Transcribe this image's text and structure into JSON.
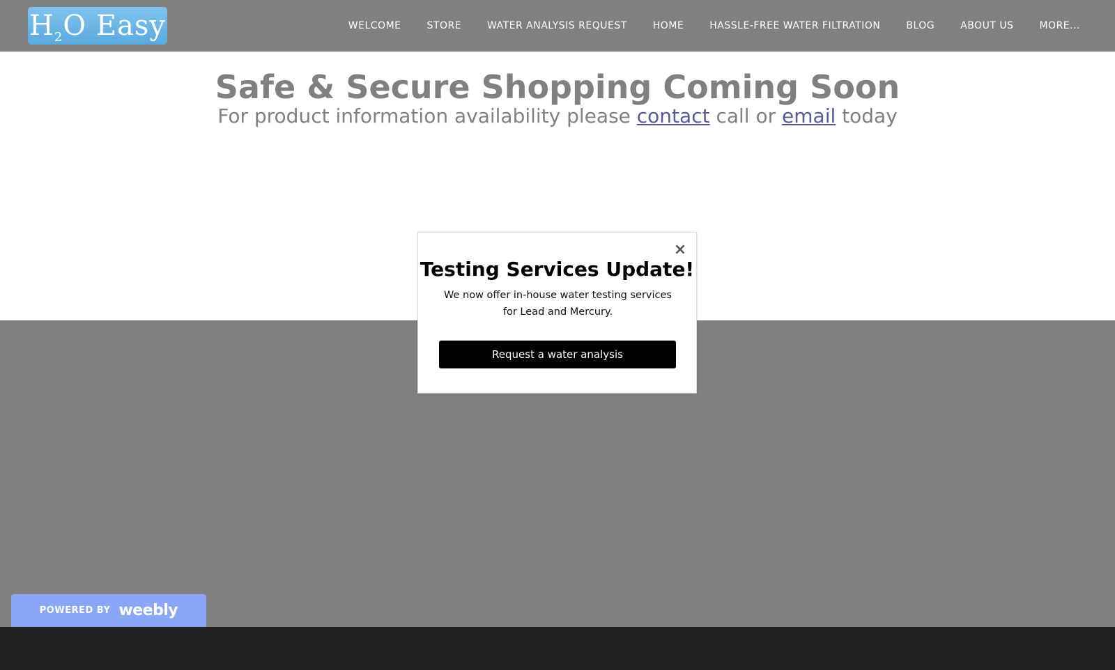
{
  "header": {
    "logo_text": "H",
    "logo_sub": "2",
    "logo_rest": "O Easy",
    "nav": [
      {
        "label": "WELCOME"
      },
      {
        "label": "STORE"
      },
      {
        "label": "WATER ANALYSIS REQUEST"
      },
      {
        "label": "HOME"
      },
      {
        "label": "HASSLE-FREE WATER FILTRATION"
      },
      {
        "label": "BLOG"
      },
      {
        "label": "ABOUT US"
      },
      {
        "label": "MORE..."
      }
    ]
  },
  "main": {
    "title": "Safe & Secure Shopping Coming Soon",
    "sub_before": "For product information availability please ",
    "contact_link": "contact",
    "sub_middle": " call or ",
    "email_link": "email",
    "sub_after": " today"
  },
  "modal": {
    "close_symbol": "×",
    "title": "Testing Services Update!",
    "text": "We now offer in-house water testing services for Lead and Mercury.",
    "button_label": "Request a water analysis"
  },
  "footer": {
    "powered_by": "POWERED BY",
    "brand": "weebly"
  },
  "colors": {
    "header_bg": "#808080",
    "gray_band": "#808080",
    "footer_bg": "#222222",
    "link": "#5a5a96",
    "badge_bg": "#89a6f7",
    "logo_bg": "#6cb6e8"
  }
}
